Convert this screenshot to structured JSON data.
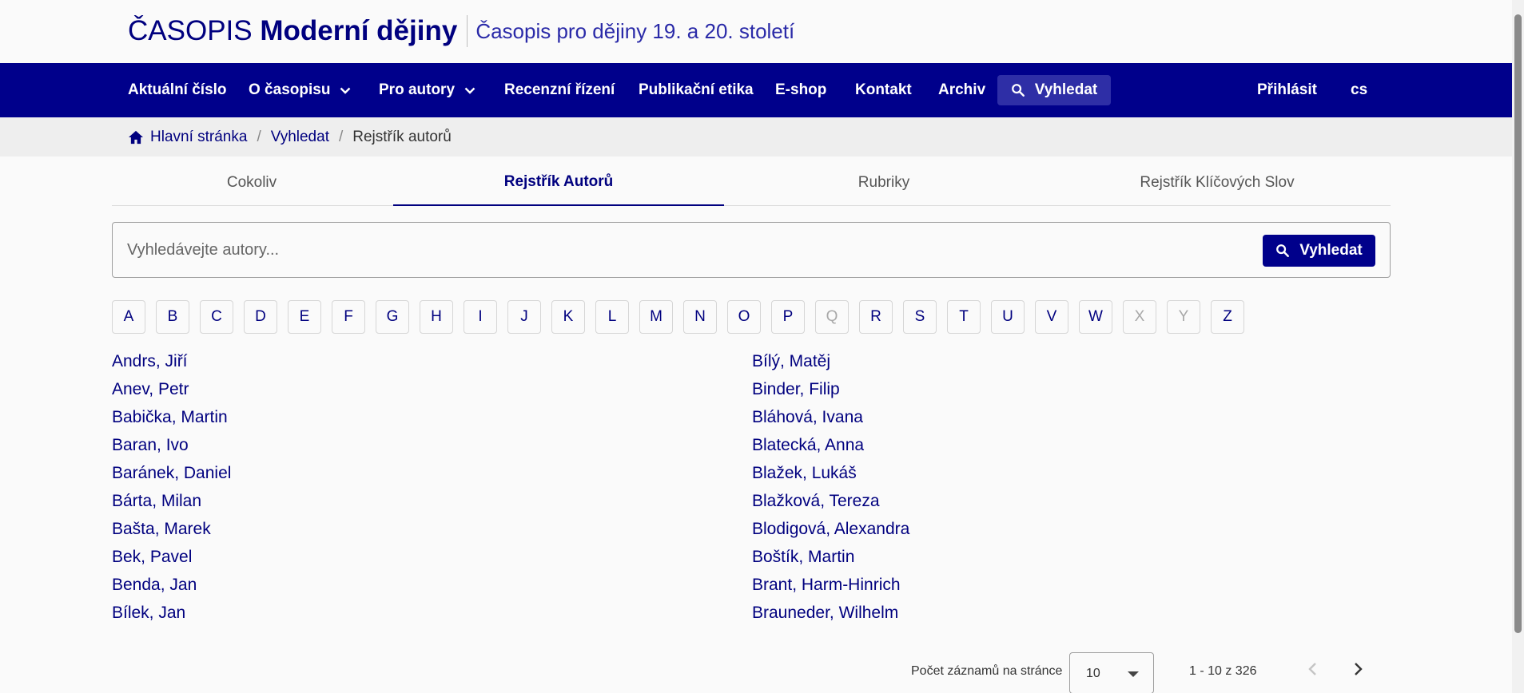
{
  "header": {
    "brand_prefix": "ČASOPIS",
    "brand_name": "Moderní dějiny",
    "subtitle": "Časopis pro dějiny 19. a 20. století"
  },
  "nav": {
    "items": [
      {
        "label": "Aktuální číslo"
      },
      {
        "label": "O časopisu"
      },
      {
        "label": "Pro autory"
      },
      {
        "label": "Recenzní řízení"
      },
      {
        "label": "Publikační etika"
      },
      {
        "label": "E-shop"
      },
      {
        "label": "Kontakt"
      },
      {
        "label": "Archiv"
      }
    ],
    "search_label": "Vyhledat",
    "login_label": "Přihlásit",
    "lang_label": "cs"
  },
  "breadcrumb": {
    "home": "Hlavní stránka",
    "search": "Vyhledat",
    "current": "Rejstřík autorů"
  },
  "tabs": [
    {
      "label": "Cokoliv",
      "active": false
    },
    {
      "label": "Rejstřík Autorů",
      "active": true
    },
    {
      "label": "Rubriky",
      "active": false
    },
    {
      "label": "Rejstřík Klíčových Slov",
      "active": false
    }
  ],
  "search": {
    "placeholder": "Vyhledávejte autory...",
    "value": "",
    "button_label": "Vyhledat"
  },
  "letters": [
    {
      "l": "A",
      "enabled": true
    },
    {
      "l": "B",
      "enabled": true
    },
    {
      "l": "C",
      "enabled": true
    },
    {
      "l": "D",
      "enabled": true
    },
    {
      "l": "E",
      "enabled": true
    },
    {
      "l": "F",
      "enabled": true
    },
    {
      "l": "G",
      "enabled": true
    },
    {
      "l": "H",
      "enabled": true
    },
    {
      "l": "I",
      "enabled": true
    },
    {
      "l": "J",
      "enabled": true
    },
    {
      "l": "K",
      "enabled": true
    },
    {
      "l": "L",
      "enabled": true
    },
    {
      "l": "M",
      "enabled": true
    },
    {
      "l": "N",
      "enabled": true
    },
    {
      "l": "O",
      "enabled": true
    },
    {
      "l": "P",
      "enabled": true
    },
    {
      "l": "Q",
      "enabled": false
    },
    {
      "l": "R",
      "enabled": true
    },
    {
      "l": "S",
      "enabled": true
    },
    {
      "l": "T",
      "enabled": true
    },
    {
      "l": "U",
      "enabled": true
    },
    {
      "l": "V",
      "enabled": true
    },
    {
      "l": "W",
      "enabled": true
    },
    {
      "l": "X",
      "enabled": false
    },
    {
      "l": "Y",
      "enabled": false
    },
    {
      "l": "Z",
      "enabled": true
    }
  ],
  "authors_left": [
    "Andrs, Jiří",
    "Anev, Petr",
    "Babička, Martin",
    "Baran, Ivo",
    "Baránek, Daniel",
    "Bárta, Milan",
    "Bašta, Marek",
    "Bek, Pavel",
    "Benda, Jan",
    "Bílek, Jan"
  ],
  "authors_right": [
    "Bílý, Matěj",
    "Binder, Filip",
    "Bláhová, Ivana",
    "Blatecká, Anna",
    "Blažek, Lukáš",
    "Blažková, Tereza",
    "Blodigová, Alexandra",
    "Boštík, Martin",
    "Brant, Harm-Hinrich",
    "Brauneder, Wilhelm"
  ],
  "pager": {
    "label": "Počet záznamů na stránce",
    "per_page": "10",
    "range": "1 - 10 z 326"
  },
  "colors": {
    "brand": "#00008b",
    "link": "#00007f"
  }
}
